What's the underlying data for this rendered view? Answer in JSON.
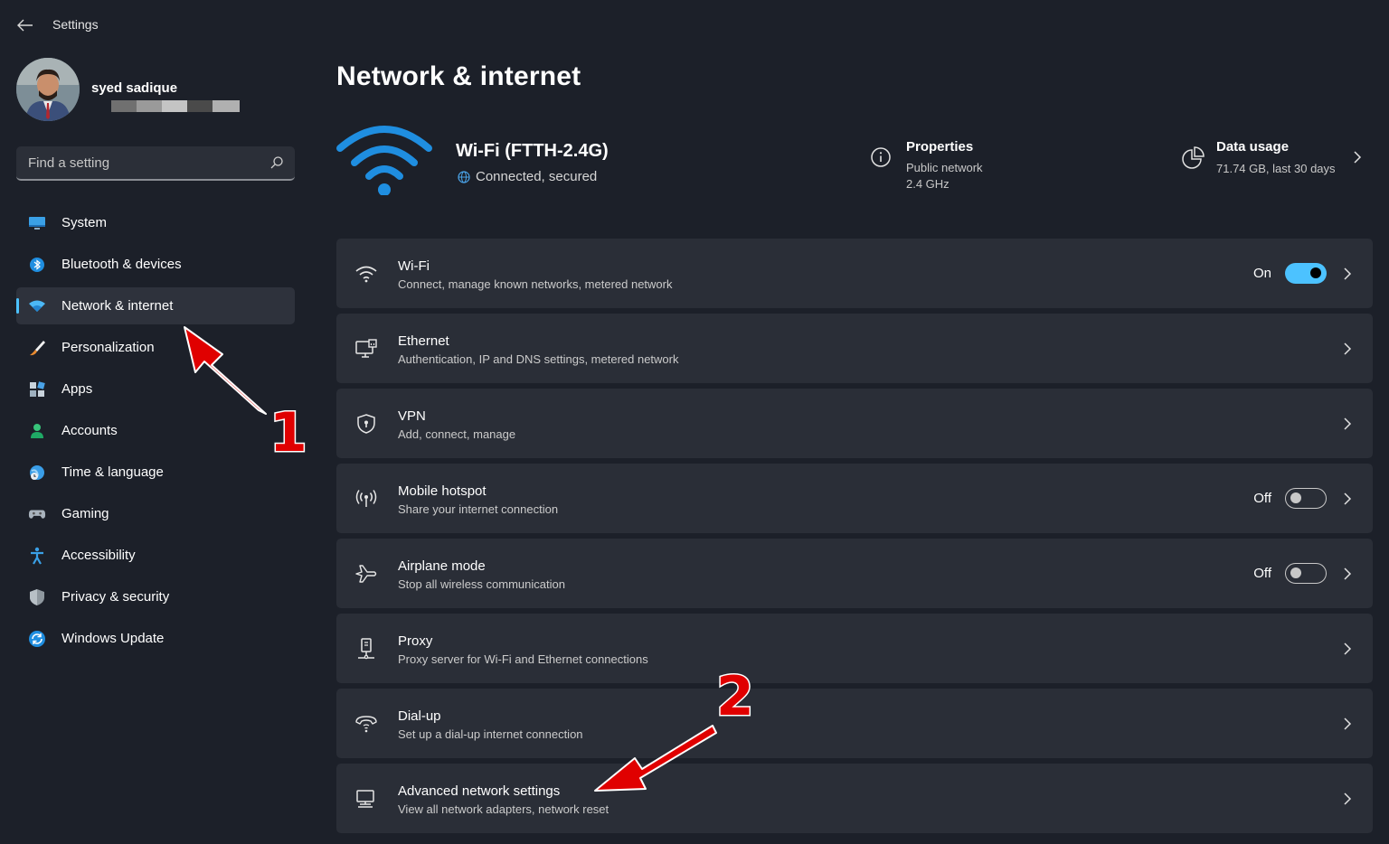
{
  "window": {
    "title": "Settings"
  },
  "profile": {
    "name": "syed sadique"
  },
  "search": {
    "placeholder": "Find a setting"
  },
  "nav": [
    {
      "label": "System",
      "icon": "monitor-icon"
    },
    {
      "label": "Bluetooth & devices",
      "icon": "bluetooth-icon"
    },
    {
      "label": "Network & internet",
      "icon": "wifi-icon",
      "active": true
    },
    {
      "label": "Personalization",
      "icon": "brush-icon"
    },
    {
      "label": "Apps",
      "icon": "apps-icon"
    },
    {
      "label": "Accounts",
      "icon": "person-icon"
    },
    {
      "label": "Time & language",
      "icon": "globe-clock-icon"
    },
    {
      "label": "Gaming",
      "icon": "controller-icon"
    },
    {
      "label": "Accessibility",
      "icon": "accessibility-icon"
    },
    {
      "label": "Privacy & security",
      "icon": "shield-icon"
    },
    {
      "label": "Windows Update",
      "icon": "update-icon"
    }
  ],
  "main": {
    "title": "Network & internet",
    "connection": {
      "name": "Wi-Fi (FTTH-2.4G)",
      "status": "Connected, secured"
    },
    "properties": {
      "title": "Properties",
      "line1": "Public network",
      "line2": "2.4 GHz"
    },
    "data_usage": {
      "title": "Data usage",
      "subtitle": "71.74 GB, last 30 days"
    },
    "rows": [
      {
        "title": "Wi-Fi",
        "subtitle": "Connect, manage known networks, metered network",
        "state": "On",
        "icon": "wifi-icon"
      },
      {
        "title": "Ethernet",
        "subtitle": "Authentication, IP and DNS settings, metered network",
        "icon": "ethernet-icon"
      },
      {
        "title": "VPN",
        "subtitle": "Add, connect, manage",
        "icon": "vpn-shield-icon"
      },
      {
        "title": "Mobile hotspot",
        "subtitle": "Share your internet connection",
        "state": "Off",
        "icon": "hotspot-icon"
      },
      {
        "title": "Airplane mode",
        "subtitle": "Stop all wireless communication",
        "state": "Off",
        "icon": "airplane-icon"
      },
      {
        "title": "Proxy",
        "subtitle": "Proxy server for Wi-Fi and Ethernet connections",
        "icon": "proxy-icon"
      },
      {
        "title": "Dial-up",
        "subtitle": "Set up a dial-up internet connection",
        "icon": "dialup-icon"
      },
      {
        "title": "Advanced network settings",
        "subtitle": "View all network adapters, network reset",
        "icon": "pc-network-icon"
      }
    ]
  },
  "annotations": {
    "label1": "1",
    "label2": "2"
  },
  "colors": {
    "accent": "#4cc2ff",
    "background": "#1c2029",
    "card": "#2a2e37",
    "annotation": "#e00000"
  }
}
